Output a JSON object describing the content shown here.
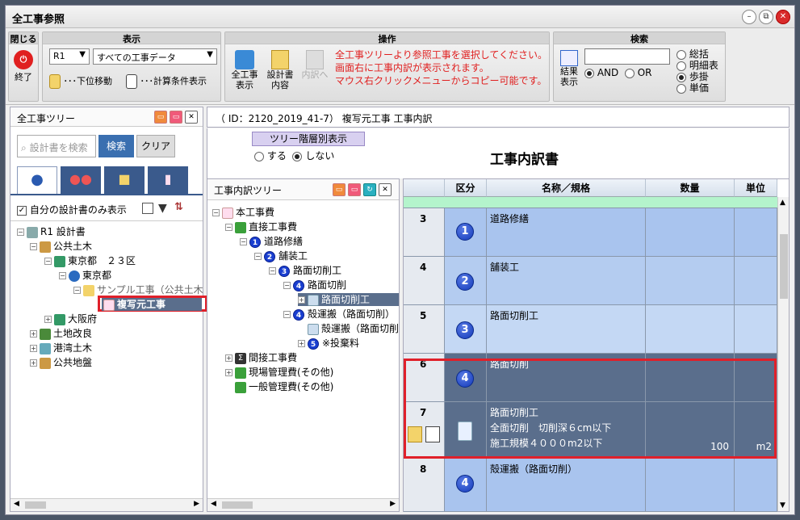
{
  "window": {
    "title": "全工事参照"
  },
  "ribbon": {
    "close_group": {
      "title": "閉じる",
      "exit_label": "終了"
    },
    "display_group": {
      "title": "表示",
      "year_select": "R1",
      "data_select": "すべての工事データ",
      "down_move": "･･･下位移動",
      "calc_display": "･･･計算条件表示"
    },
    "ops_group": {
      "title": "操作",
      "btn1_line1": "全工事",
      "btn1_line2": "表示",
      "btn2_line1": "設計書",
      "btn2_line2": "内容",
      "btn3": "内訳へ",
      "msg1": "全工事ツリーより参照工事を選択してください。",
      "msg2": "画面右に工事内訳が表示されます。",
      "msg3": "マウス右クリックメニューからコピー可能です。"
    },
    "search_group": {
      "title": "検索",
      "result_line1": "結果",
      "result_line2": "表示",
      "and": "AND",
      "or": "OR",
      "opt1": "総括",
      "opt2": "明細表",
      "opt3": "歩掛",
      "opt4": "単価"
    }
  },
  "left_panel": {
    "title": "全工事ツリー",
    "search_placeholder": "設計書を検索",
    "search_btn": "検索",
    "clear_btn": "クリア",
    "own_only": "自分の設計書のみ表示",
    "tree": [
      "R1 設計書",
      "公共土木",
      "東京都　２３区",
      "東京都",
      "サンプル工事（公共土木",
      "複写元工事",
      "大阪府",
      "土地改良",
      "港湾土木",
      "公共地盤"
    ]
  },
  "right_header": {
    "path": "（ ID：2120_2019_41-7） 複写元工事 工事内訳"
  },
  "mid_panel": {
    "tree_btn": "ツリー階層別表示",
    "yes": "する",
    "no": "しない",
    "doc_title": "工事内訳書",
    "title": "工事内訳ツリー",
    "tree": [
      "本工事費",
      "直接工事費",
      "道路修繕",
      "舗装工",
      "路面切削工",
      "路面切削",
      "路面切削工",
      "殻運搬（路面切削）",
      "殻運搬（路面切削",
      "※投棄料",
      "間接工事費",
      "現場管理費(その他)",
      "一般管理費(その他)"
    ]
  },
  "grid": {
    "headers": [
      "区分",
      "名称／規格",
      "数量",
      "単位"
    ],
    "rows": [
      {
        "no": "3",
        "num": "1",
        "name": "道路修繕",
        "sub1": "",
        "sub2": "",
        "qty": "",
        "unit": ""
      },
      {
        "no": "4",
        "num": "2",
        "name": "舗装工",
        "sub1": "",
        "sub2": "",
        "qty": "",
        "unit": ""
      },
      {
        "no": "5",
        "num": "3",
        "name": "路面切削工",
        "sub1": "",
        "sub2": "",
        "qty": "",
        "unit": ""
      },
      {
        "no": "6",
        "num": "4",
        "name": "路面切削",
        "sub1": "",
        "sub2": "",
        "qty": "",
        "unit": ""
      },
      {
        "no": "7",
        "num": "",
        "name": "路面切削工",
        "sub1": "全面切削　切削深６cm以下",
        "sub2": "施工規模４０００m2以下",
        "qty": "100",
        "unit": "m2"
      },
      {
        "no": "8",
        "num": "4",
        "name": "殻運搬（路面切削）",
        "sub1": "",
        "sub2": "",
        "qty": "",
        "unit": ""
      }
    ]
  },
  "colors": {
    "accent": "#e0202a",
    "dark_row": "#5a6e8c",
    "light_row": "#a9c4ee",
    "header_green": "#a8f0c8"
  }
}
